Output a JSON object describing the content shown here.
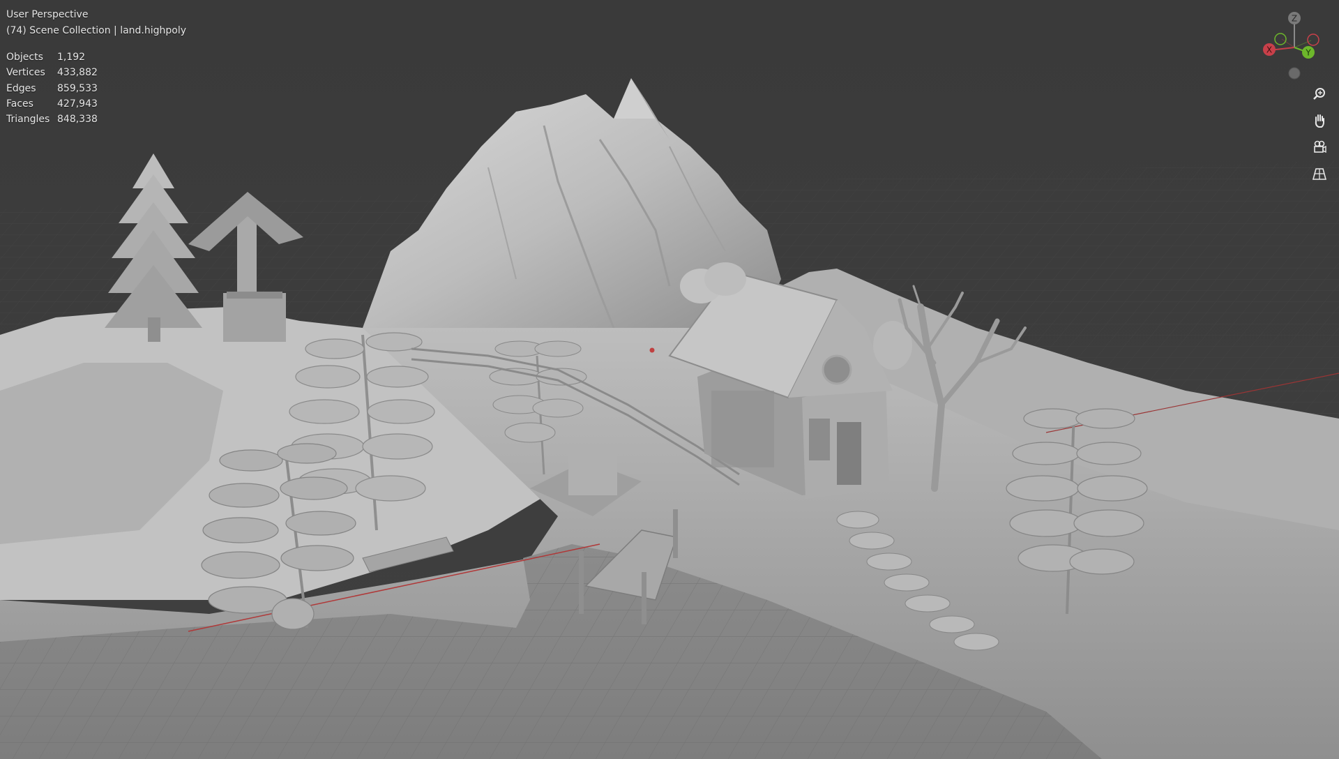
{
  "viewport": {
    "view_name": "User Perspective",
    "scene_info": "(74) Scene Collection | land.highpoly"
  },
  "stats": [
    {
      "label": "Objects",
      "value": "1,192"
    },
    {
      "label": "Vertices",
      "value": "433,882"
    },
    {
      "label": "Edges",
      "value": "859,533"
    },
    {
      "label": "Faces",
      "value": "427,943"
    },
    {
      "label": "Triangles",
      "value": "848,338"
    }
  ],
  "gizmo": {
    "z_label": "Z",
    "x_label": "X",
    "y_label": "Y",
    "colors": {
      "x": "#c8404a",
      "y": "#6db72b",
      "z": "#8a8a8a"
    }
  },
  "nav_tools": [
    {
      "name": "zoom-icon"
    },
    {
      "name": "pan-hand-icon"
    },
    {
      "name": "camera-view-icon"
    },
    {
      "name": "perspective-grid-icon"
    }
  ]
}
